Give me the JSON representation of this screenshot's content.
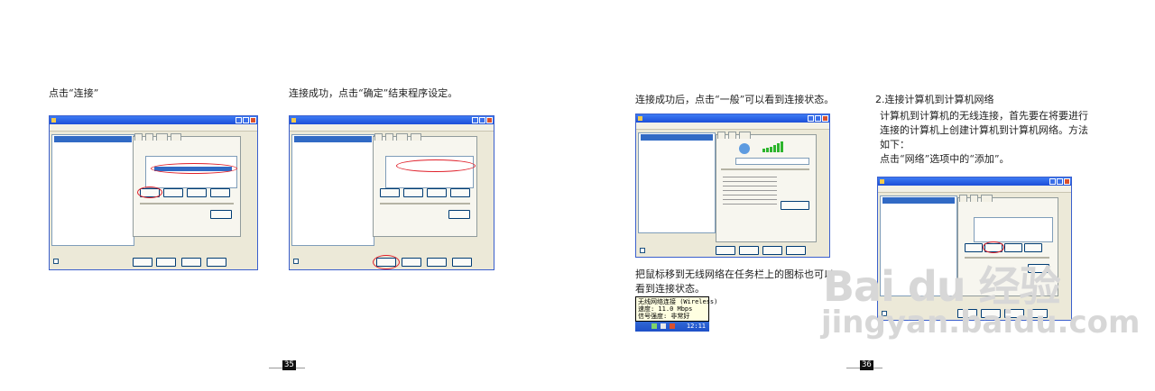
{
  "page_left": {
    "caption_1": "点击“连接”",
    "caption_2": "连接成功，点击“确定”结束程序设定。",
    "page_number": "35"
  },
  "page_right": {
    "caption_3": "连接成功后，点击“一般”可以看到连接状态。",
    "section_title": "2.连接计算机到计算机网络",
    "para_line_1": "计算机到计算机的无线连接，首先要在将要进行",
    "para_line_2": "连接的计算机上创建计算机到计算机网络。方法",
    "para_line_3": "如下：",
    "para_line_4": "点击“网络”选项中的“添加”。",
    "tray_caption_1": "把鼠标移到无线网络在任务栏上的图标也可以",
    "tray_caption_2": "看到连接状态。",
    "page_number": "36"
  },
  "tray_popup": {
    "line_1": "无线网络连接 (Wireless)",
    "line_2": "速度: 11.0 Mbps",
    "line_3": "信号强度: 非常好",
    "clock": "12:11"
  },
  "watermark": {
    "brand": "Bai du 经验",
    "url": "jingyan.baidu.com"
  },
  "colors": {
    "highlight_oval": "#e0202a",
    "xp_title_blue": "#1c4fd8",
    "signal_green": "#2db52d"
  },
  "icons": [
    "wifi-tray-icon",
    "network-icon",
    "signal-bars-icon"
  ]
}
